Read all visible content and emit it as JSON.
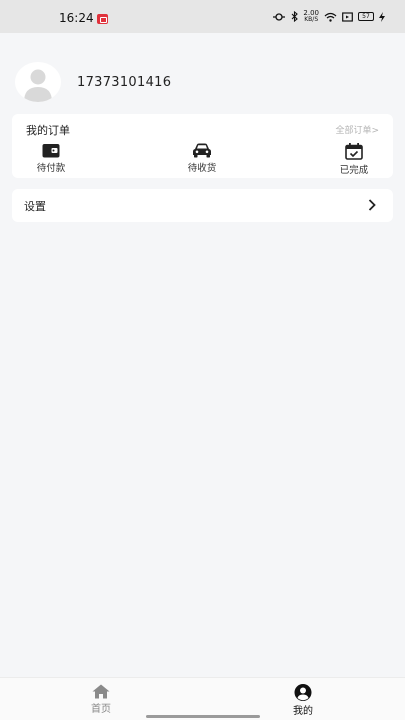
{
  "status_bar": {
    "time": "16:24",
    "speed_value": "2.00",
    "speed_unit": "KB/S",
    "battery": "57"
  },
  "profile": {
    "phone": "17373101416"
  },
  "orders": {
    "title": "我的订单",
    "all_link": "全部订单>",
    "items": [
      {
        "label": "待付款",
        "icon": "wallet-icon"
      },
      {
        "label": "待收货",
        "icon": "car-icon"
      },
      {
        "label": "已完成",
        "icon": "calendar-check-icon"
      }
    ]
  },
  "settings": {
    "label": "设置"
  },
  "bottom_nav": {
    "items": [
      {
        "label": "首页",
        "icon": "home-icon",
        "active": false
      },
      {
        "label": "我的",
        "icon": "user-circle-icon",
        "active": true
      }
    ]
  }
}
